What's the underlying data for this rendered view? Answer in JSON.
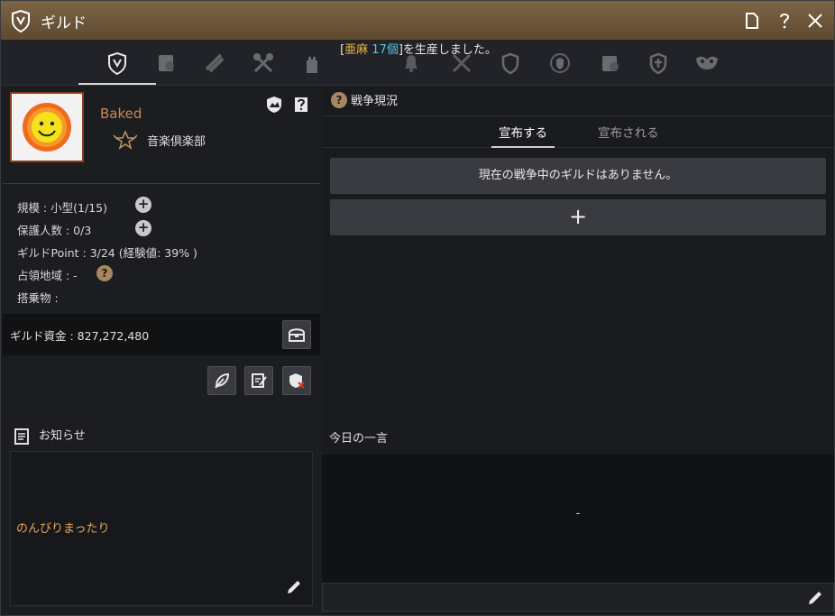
{
  "window": {
    "title": "ギルド"
  },
  "notification": {
    "prefix": "[",
    "item": "亜麻",
    "count": "17個",
    "suffix": "]を生産しました。"
  },
  "tabs": [
    {
      "icon": "guild-crest-icon"
    },
    {
      "icon": "members-icon"
    },
    {
      "icon": "quest-scroll-icon"
    },
    {
      "icon": "crossed-axes-icon"
    },
    {
      "icon": "castle-tower-icon"
    },
    {
      "icon": "bell-icon"
    },
    {
      "icon": "crossed-swords-icon"
    },
    {
      "icon": "shield-icon"
    },
    {
      "icon": "laurel-shield-icon"
    },
    {
      "icon": "house-member-icon"
    },
    {
      "icon": "cross-shield-icon"
    },
    {
      "icon": "mask-icon"
    }
  ],
  "guild": {
    "name": "Baked",
    "club_name": "音楽倶楽部"
  },
  "stats": {
    "scale": "規模 : 小型(1/15)",
    "protected": "保護人数 : 0/3",
    "points": "ギルドPoint : 3/24 (経験値: 39% )",
    "territory": "占領地域 : -",
    "vehicle": "搭乗物 :"
  },
  "funds": {
    "label": "ギルド資金 : 827,272,480"
  },
  "notice": {
    "title": "お知らせ",
    "text": "のんびりまったり"
  },
  "war": {
    "title": "戦争現況",
    "tab_declare": "宣布する",
    "tab_declared": "宣布される",
    "empty": "現在の戦争中のギルドはありません。",
    "add": "+"
  },
  "daily": {
    "title": "今日の一言",
    "value": "-"
  },
  "colors": {
    "title_bar": "#6e5739",
    "accent_orange": "#e8a85a",
    "highlight_cyan": "#56c6e8",
    "highlight_gold": "#f0b640"
  }
}
